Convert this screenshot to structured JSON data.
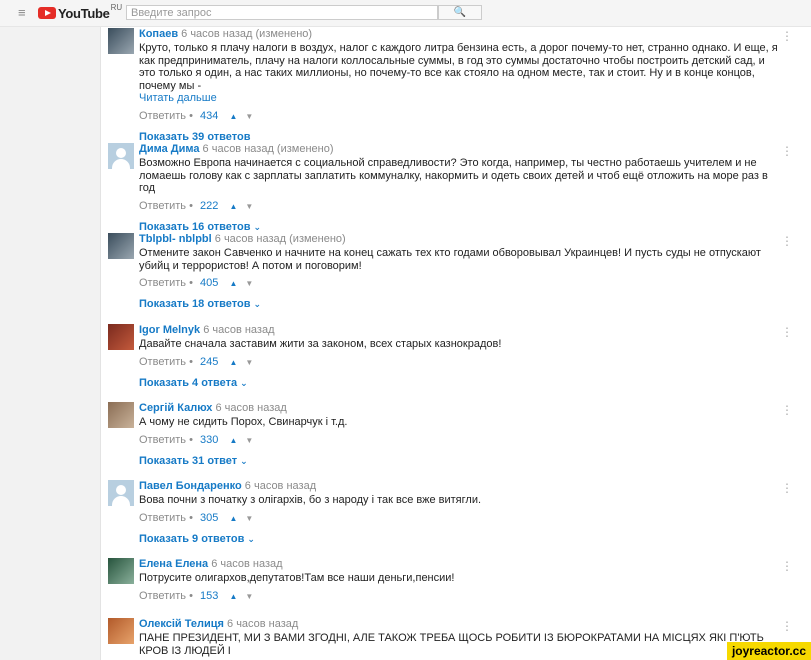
{
  "header": {
    "logo_text": "YouTube",
    "region": "RU",
    "search_placeholder": "Введите запрос",
    "search_button": "🔍"
  },
  "common": {
    "reply_label": "Ответить",
    "bullet": "•"
  },
  "comments": [
    {
      "author": "Копаев",
      "time": "6 часов назад (изменено)",
      "text": "Круто, только я плачу налоги в воздух, налог с каждого литра бензина есть, а дорог почему-то нет, странно однако. И еще, я как предприниматель, плачу на налоги коллосальные суммы, в год это суммы достаточно чтобы построить детский сад, и это только я один, а нас таких миллионы, но почему-то все как стояло на одном месте, так и стоит. Ну и в конце концов, почему мы -",
      "read_more": "Читать дальше",
      "likes": "434",
      "replies": "Показать 39 ответов"
    },
    {
      "author": "Дима Дима",
      "time": "6 часов назад (изменено)",
      "text": "Возможно Европа начинается с социальной справедливости? Это когда, например, ты честно работаешь учителем и не ломаешь голову как с зарплаты заплатить коммуналку, накормить и одеть своих детей и чтоб ещё отложить на море раз в год",
      "likes": "222",
      "replies": "Показать 16 ответов"
    },
    {
      "author": "Tblpbl- nblpbl",
      "time": "6 часов назад (изменено)",
      "text": "Отмените закон Савченко и начните на конец сажать тех кто годами обворовывал Украинцев! И пусть суды не отпускают убийц и террористов! А потом и поговорим!",
      "likes": "405",
      "replies": "Показать 18 ответов"
    },
    {
      "author": "Igor Melnyk",
      "time": "6 часов назад",
      "text": "Давайте сначала заставим жити за законом, всех старых казнокрадов!",
      "likes": "245",
      "replies": "Показать 4 ответа"
    },
    {
      "author": "Сергій Калюх",
      "time": "6 часов назад",
      "text": "А чому не сидить Порох, Свинарчук і т.д.",
      "likes": "330",
      "replies": "Показать 31 ответ"
    },
    {
      "author": "Павел Бондаренко",
      "time": "6 часов назад",
      "text": "Вова почни з початку з олігархів, бо з народу і так все вже витягли.",
      "likes": "305",
      "replies": "Показать 9 ответов"
    },
    {
      "author": "Елена Елена",
      "time": "6 часов назад",
      "text": "Потрусите олигархов,депутатов!Там все наши деньги,пенсии!",
      "likes": "153",
      "replies": ""
    },
    {
      "author": "Олексій Телиця",
      "time": "6 часов назад",
      "text": "ПАНЕ ПРЕЗИДЕНТ, МИ З ВАМИ ЗГОДНІ, АЛЕ ТАКОЖ ТРЕБА ЩОСЬ РОБИТИ ІЗ БЮРОКРАТАМИ НА МІСЦЯХ ЯКІ П'ЮТЬ КРОВ ІЗ ЛЮДЕЙ І",
      "likes": "",
      "replies": ""
    }
  ],
  "watermark": "joyreactor.cc"
}
